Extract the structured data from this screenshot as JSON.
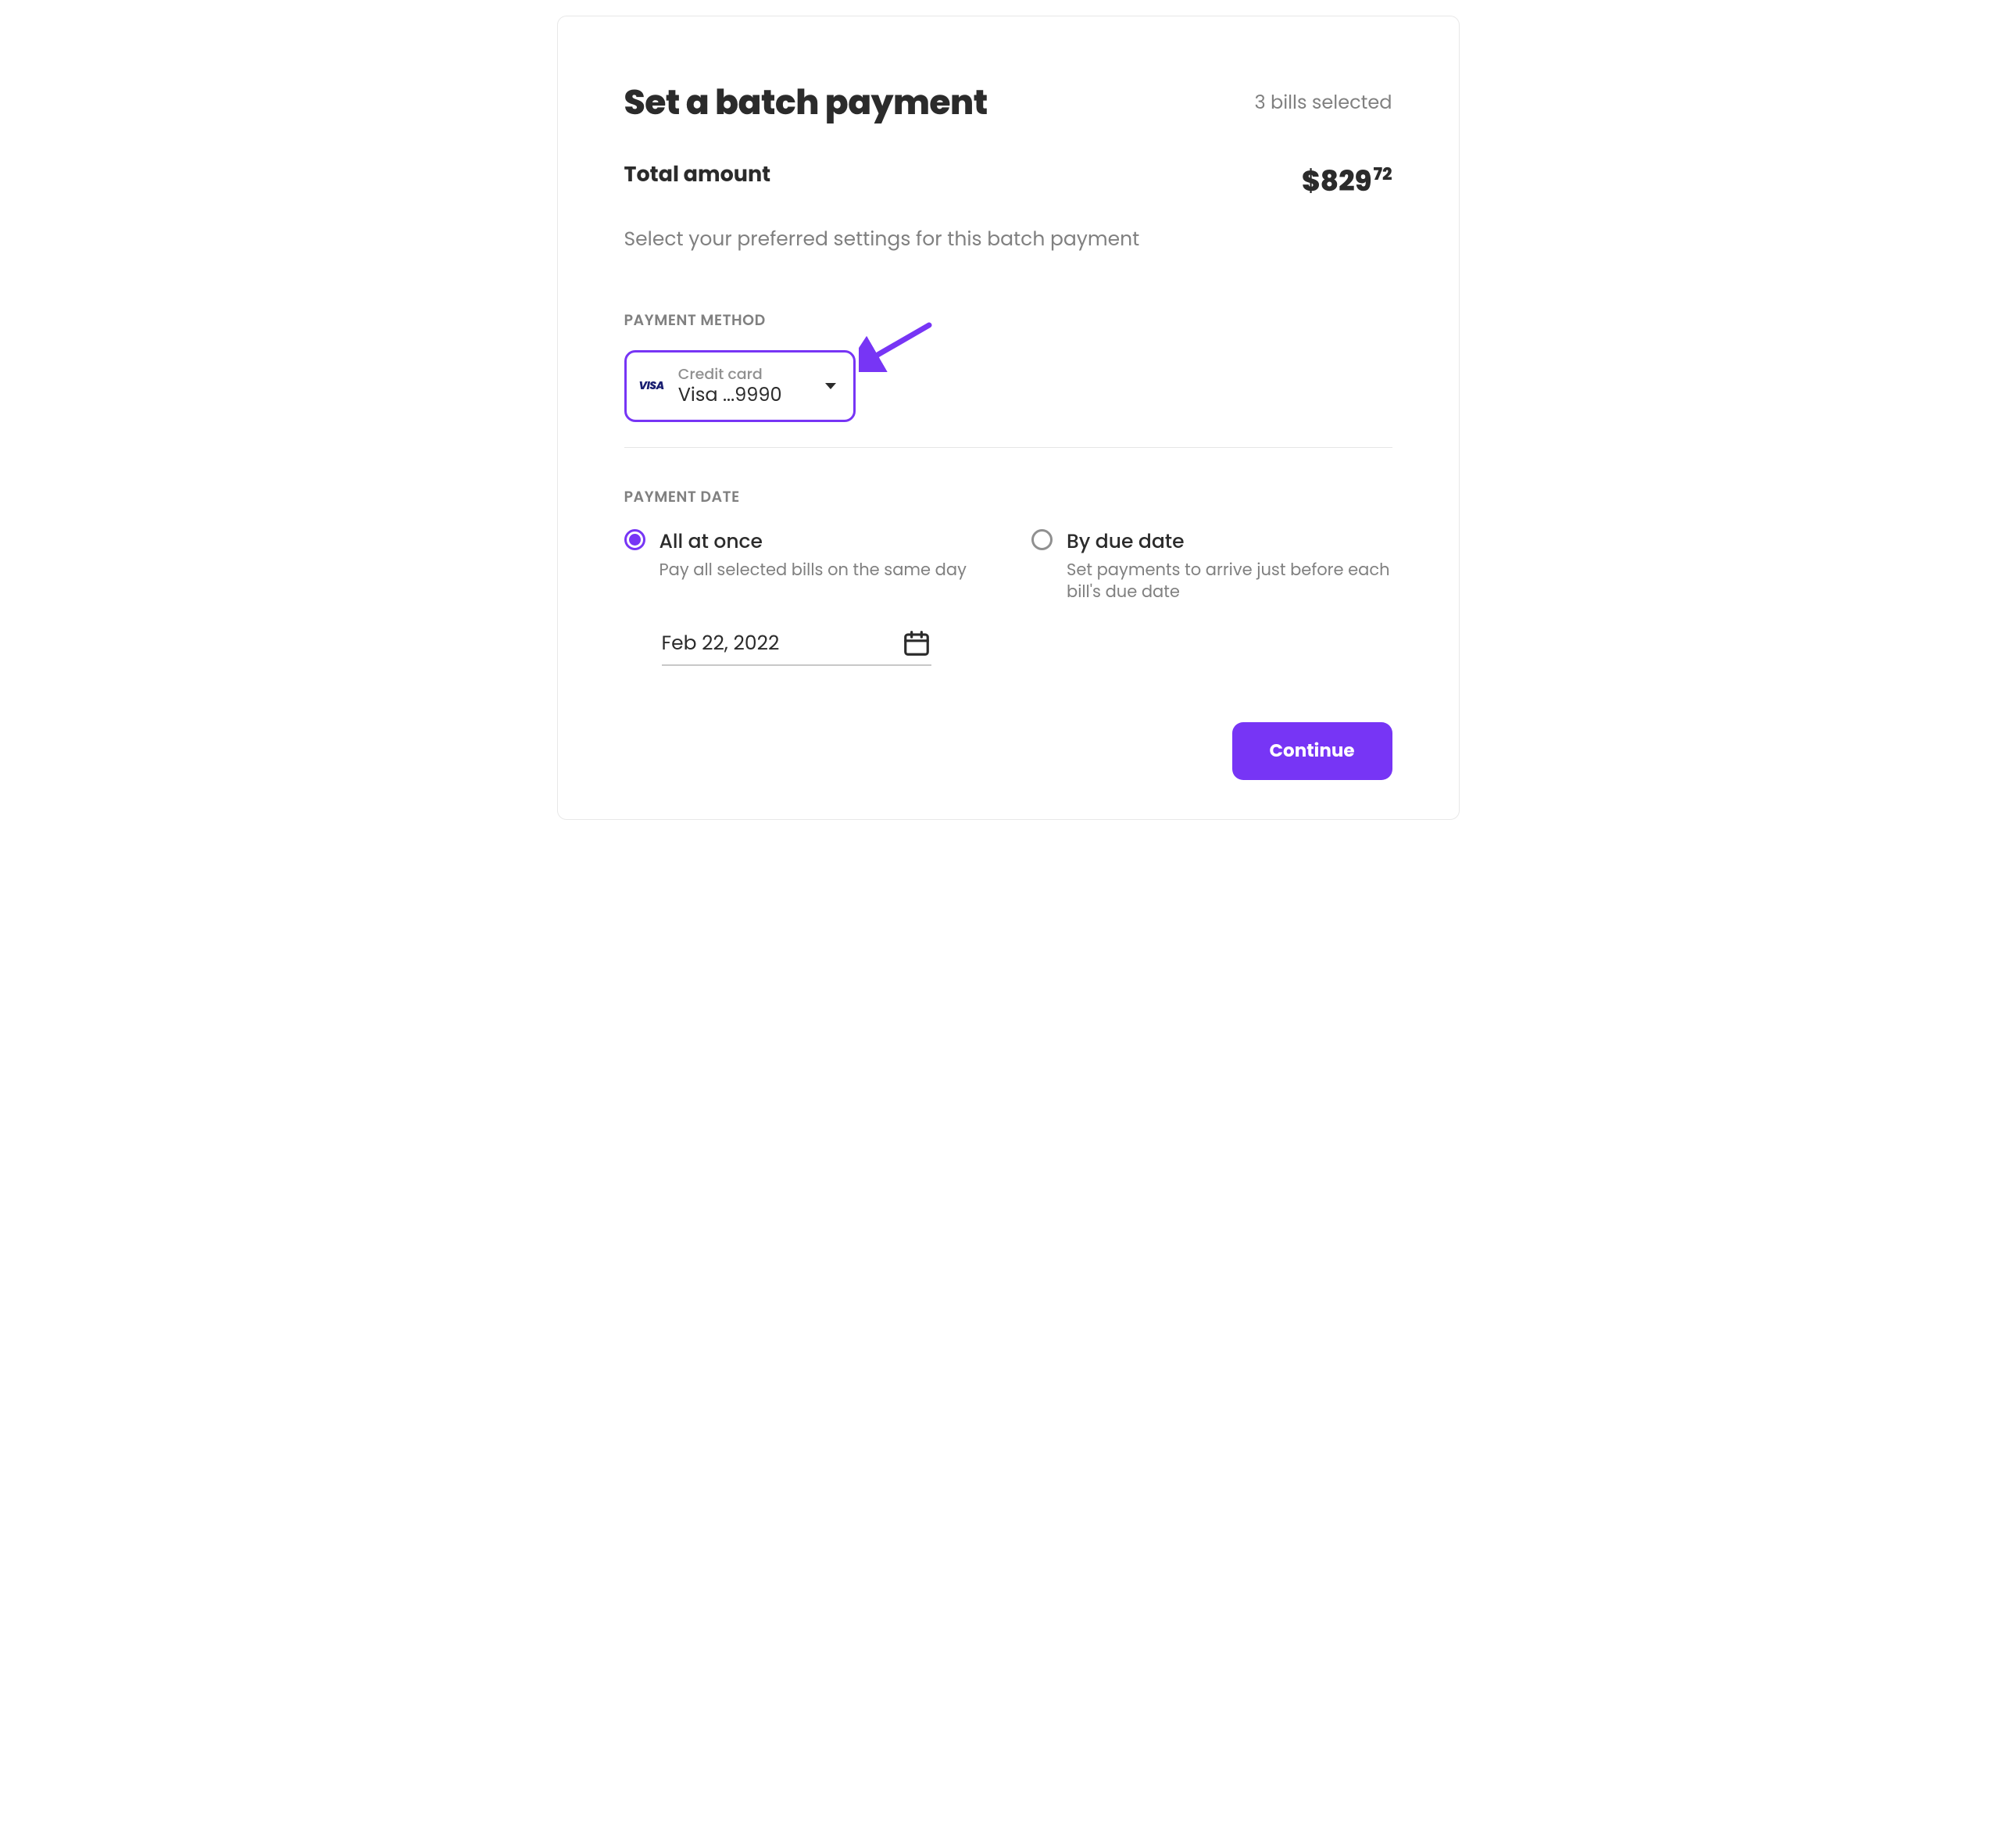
{
  "header": {
    "title": "Set a batch payment",
    "bills_count": "3 bills selected"
  },
  "total": {
    "label": "Total amount",
    "currency": "$",
    "whole": "829",
    "cents": "72"
  },
  "subtitle": "Select your preferred settings for this batch payment",
  "payment_method": {
    "section_label": "PAYMENT METHOD",
    "brand_logo_text": "VISA",
    "type_label": "Credit card",
    "display": "Visa ...9990"
  },
  "payment_date": {
    "section_label": "PAYMENT DATE",
    "options": [
      {
        "title": "All at once",
        "desc": "Pay all selected bills on the same day",
        "selected": true
      },
      {
        "title": "By due date",
        "desc": "Set payments to arrive just before each bill's due date",
        "selected": false
      }
    ],
    "date_value": "Feb 22, 2022"
  },
  "actions": {
    "continue_label": "Continue"
  }
}
